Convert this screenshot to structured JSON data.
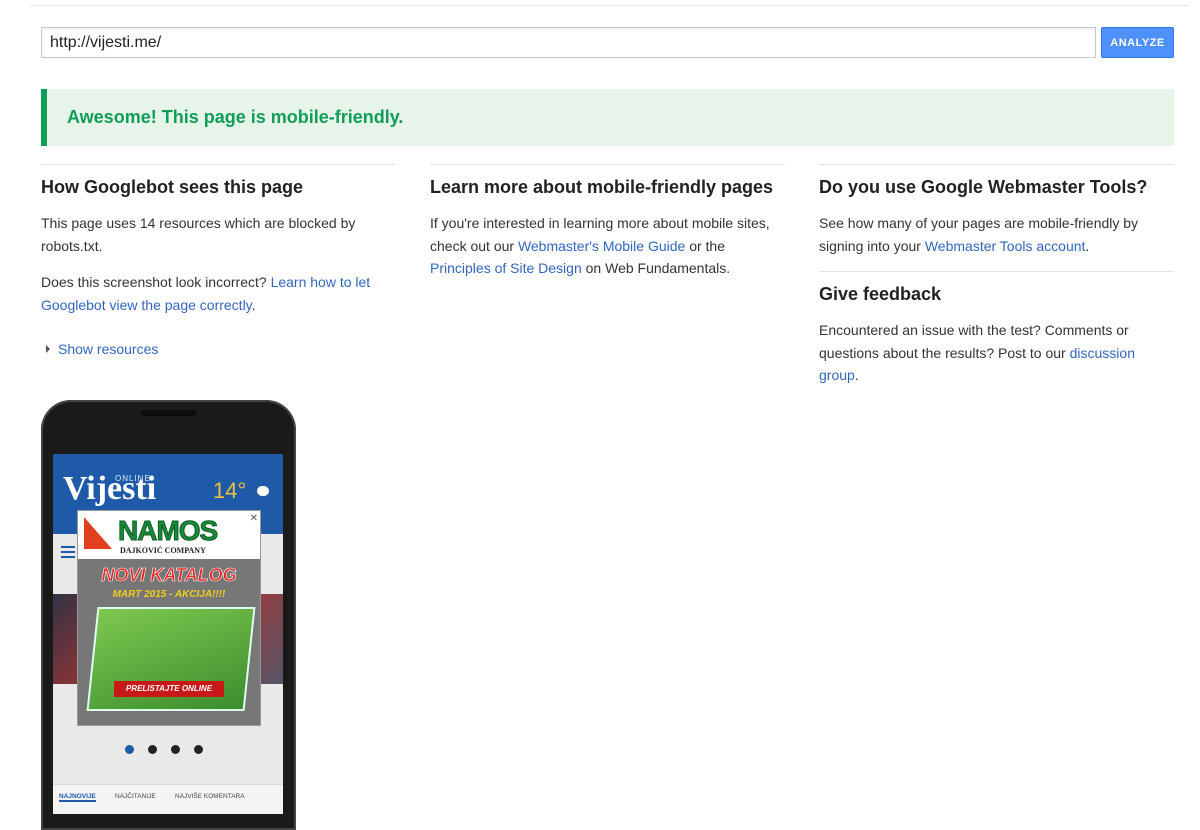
{
  "search": {
    "url_value": "http://vijesti.me/",
    "analyze_label": "ANALYZE"
  },
  "banner": {
    "message": "Awesome! This page is mobile-friendly."
  },
  "colors": {
    "accent": "#4d90fe",
    "success": "#0f9d58",
    "link": "#3366bb"
  },
  "googlebot": {
    "title": "How Googlebot sees this page",
    "blocked_text": "This page uses 14 resources which are blocked by robots.txt.",
    "incorrect_prefix": "Does this screenshot look incorrect? ",
    "incorrect_link": "Learn how to let Googlebot view the page correctly",
    "incorrect_suffix": ".",
    "show_resources": "Show resources"
  },
  "learn_more": {
    "title": "Learn more about mobile-friendly pages",
    "text_prefix": "If you're interested in learning more about mobile sites, check out our ",
    "link1": "Webmaster's Mobile Guide",
    "text_mid": " or the ",
    "link2": "Principles of Site Design",
    "text_suffix": " on Web Fundamentals."
  },
  "webmaster": {
    "title": "Do you use Google Webmaster Tools?",
    "text_prefix": "See how many of your pages are mobile-friendly by signing into your ",
    "link": "Webmaster Tools account",
    "text_suffix": "."
  },
  "feedback": {
    "title": "Give feedback",
    "text_prefix": "Encountered an issue with the test? Comments or questions about the results? Post to our ",
    "link": "discussion group",
    "text_suffix": "."
  },
  "phone_preview": {
    "site_logo": "Vijesti",
    "site_tag": "ONLINE",
    "temperature": "14°",
    "ad_brand": "NAMOS",
    "ad_company": "DAJKOVIĆ COMPANY",
    "ad_headline": "NOVI KATALOG",
    "ad_date": "MART 2015 - AKCIJA!!!!",
    "ad_cta": "PRELISTAJTE ONLINE",
    "tabs": [
      "NAJNOVIJE",
      "NAJČITANIJE",
      "NAJVIŠE KOMENTARA"
    ],
    "carousel_active_index": 0,
    "carousel_count": 4
  }
}
